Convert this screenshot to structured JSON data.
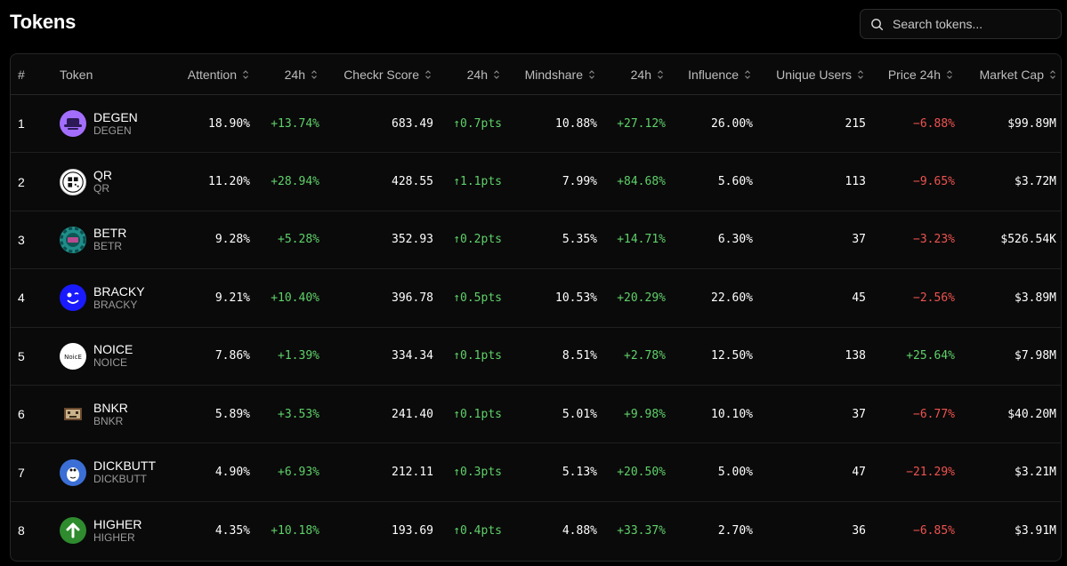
{
  "header": {
    "title": "Tokens"
  },
  "search": {
    "placeholder": "Search tokens..."
  },
  "table": {
    "columns": {
      "rank": "#",
      "token": "Token",
      "attention": "Attention",
      "attention_24h": "24h",
      "checkr_score": "Checkr Score",
      "checkr_24h": "24h",
      "mindshare": "Mindshare",
      "mindshare_24h": "24h",
      "influence": "Influence",
      "unique_users": "Unique Users",
      "price_24h": "Price 24h",
      "market_cap": "Market Cap"
    },
    "rows": [
      {
        "rank": "1",
        "name": "DEGEN",
        "symbol": "DEGEN",
        "icon": "degen-hat-icon",
        "attention": "18.90%",
        "attention_24h": "+13.74%",
        "checkr_score": "683.49",
        "checkr_24h": "↑0.7pts",
        "mindshare": "10.88%",
        "mindshare_24h": "+27.12%",
        "influence": "26.00%",
        "unique_users": "215",
        "price_24h": "−6.88%",
        "market_cap": "$99.89M"
      },
      {
        "rank": "2",
        "name": "QR",
        "symbol": "QR",
        "icon": "qr-icon",
        "attention": "11.20%",
        "attention_24h": "+28.94%",
        "checkr_score": "428.55",
        "checkr_24h": "↑1.1pts",
        "mindshare": "7.99%",
        "mindshare_24h": "+84.68%",
        "influence": "5.60%",
        "unique_users": "113",
        "price_24h": "−9.65%",
        "market_cap": "$3.72M"
      },
      {
        "rank": "3",
        "name": "BETR",
        "symbol": "BETR",
        "icon": "betr-chip-icon",
        "attention": "9.28%",
        "attention_24h": "+5.28%",
        "checkr_score": "352.93",
        "checkr_24h": "↑0.2pts",
        "mindshare": "5.35%",
        "mindshare_24h": "+14.71%",
        "influence": "6.30%",
        "unique_users": "37",
        "price_24h": "−3.23%",
        "market_cap": "$526.54K"
      },
      {
        "rank": "4",
        "name": "BRACKY",
        "symbol": "BRACKY",
        "icon": "bracky-face-icon",
        "attention": "9.21%",
        "attention_24h": "+10.40%",
        "checkr_score": "396.78",
        "checkr_24h": "↑0.5pts",
        "mindshare": "10.53%",
        "mindshare_24h": "+20.29%",
        "influence": "22.60%",
        "unique_users": "45",
        "price_24h": "−2.56%",
        "market_cap": "$3.89M"
      },
      {
        "rank": "5",
        "name": "NOICE",
        "symbol": "NOICE",
        "icon": "noice-logo-icon",
        "attention": "7.86%",
        "attention_24h": "+1.39%",
        "checkr_score": "334.34",
        "checkr_24h": "↑0.1pts",
        "mindshare": "8.51%",
        "mindshare_24h": "+2.78%",
        "influence": "12.50%",
        "unique_users": "138",
        "price_24h": "+25.64%",
        "market_cap": "$7.98M"
      },
      {
        "rank": "6",
        "name": "BNKR",
        "symbol": "BNKR",
        "icon": "bnkr-pixel-icon",
        "attention": "5.89%",
        "attention_24h": "+3.53%",
        "checkr_score": "241.40",
        "checkr_24h": "↑0.1pts",
        "mindshare": "5.01%",
        "mindshare_24h": "+9.98%",
        "influence": "10.10%",
        "unique_users": "37",
        "price_24h": "−6.77%",
        "market_cap": "$40.20M"
      },
      {
        "rank": "7",
        "name": "DICKBUTT",
        "symbol": "DICKBUTT",
        "icon": "dickbutt-icon",
        "attention": "4.90%",
        "attention_24h": "+6.93%",
        "checkr_score": "212.11",
        "checkr_24h": "↑0.3pts",
        "mindshare": "5.13%",
        "mindshare_24h": "+20.50%",
        "influence": "5.00%",
        "unique_users": "47",
        "price_24h": "−21.29%",
        "market_cap": "$3.21M"
      },
      {
        "rank": "8",
        "name": "HIGHER",
        "symbol": "HIGHER",
        "icon": "higher-arrow-icon",
        "attention": "4.35%",
        "attention_24h": "+10.18%",
        "checkr_score": "193.69",
        "checkr_24h": "↑0.4pts",
        "mindshare": "4.88%",
        "mindshare_24h": "+33.37%",
        "influence": "2.70%",
        "unique_users": "36",
        "price_24h": "−6.85%",
        "market_cap": "$3.91M"
      }
    ]
  },
  "colors": {
    "positive": "#5fd16a",
    "negative": "#ef5350",
    "background": "#000000",
    "border": "#262626"
  }
}
